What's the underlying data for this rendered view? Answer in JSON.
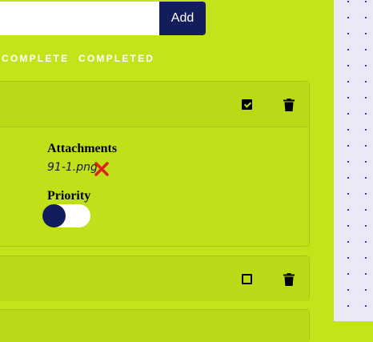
{
  "new_task": {
    "value": "",
    "placeholder": "",
    "add_label": "Add"
  },
  "filters": [
    "COMPLETE",
    "COMPLETED"
  ],
  "tasks": [
    {
      "completed": true,
      "checkbox_icon": "checked-box-icon",
      "delete_icon": "trash-icon",
      "attachments_heading": "Attachments",
      "attachment_file": "91-1.png",
      "remove_icon": "red-x-icon",
      "priority_heading": "Priority",
      "priority_on": false
    },
    {
      "completed": false,
      "checkbox_icon": "empty-box-icon",
      "delete_icon": "trash-icon"
    }
  ],
  "colors": {
    "background": "#c3e31b",
    "accent": "#141d5c",
    "remove": "#e0201c",
    "dots": "#2a2ab0"
  }
}
